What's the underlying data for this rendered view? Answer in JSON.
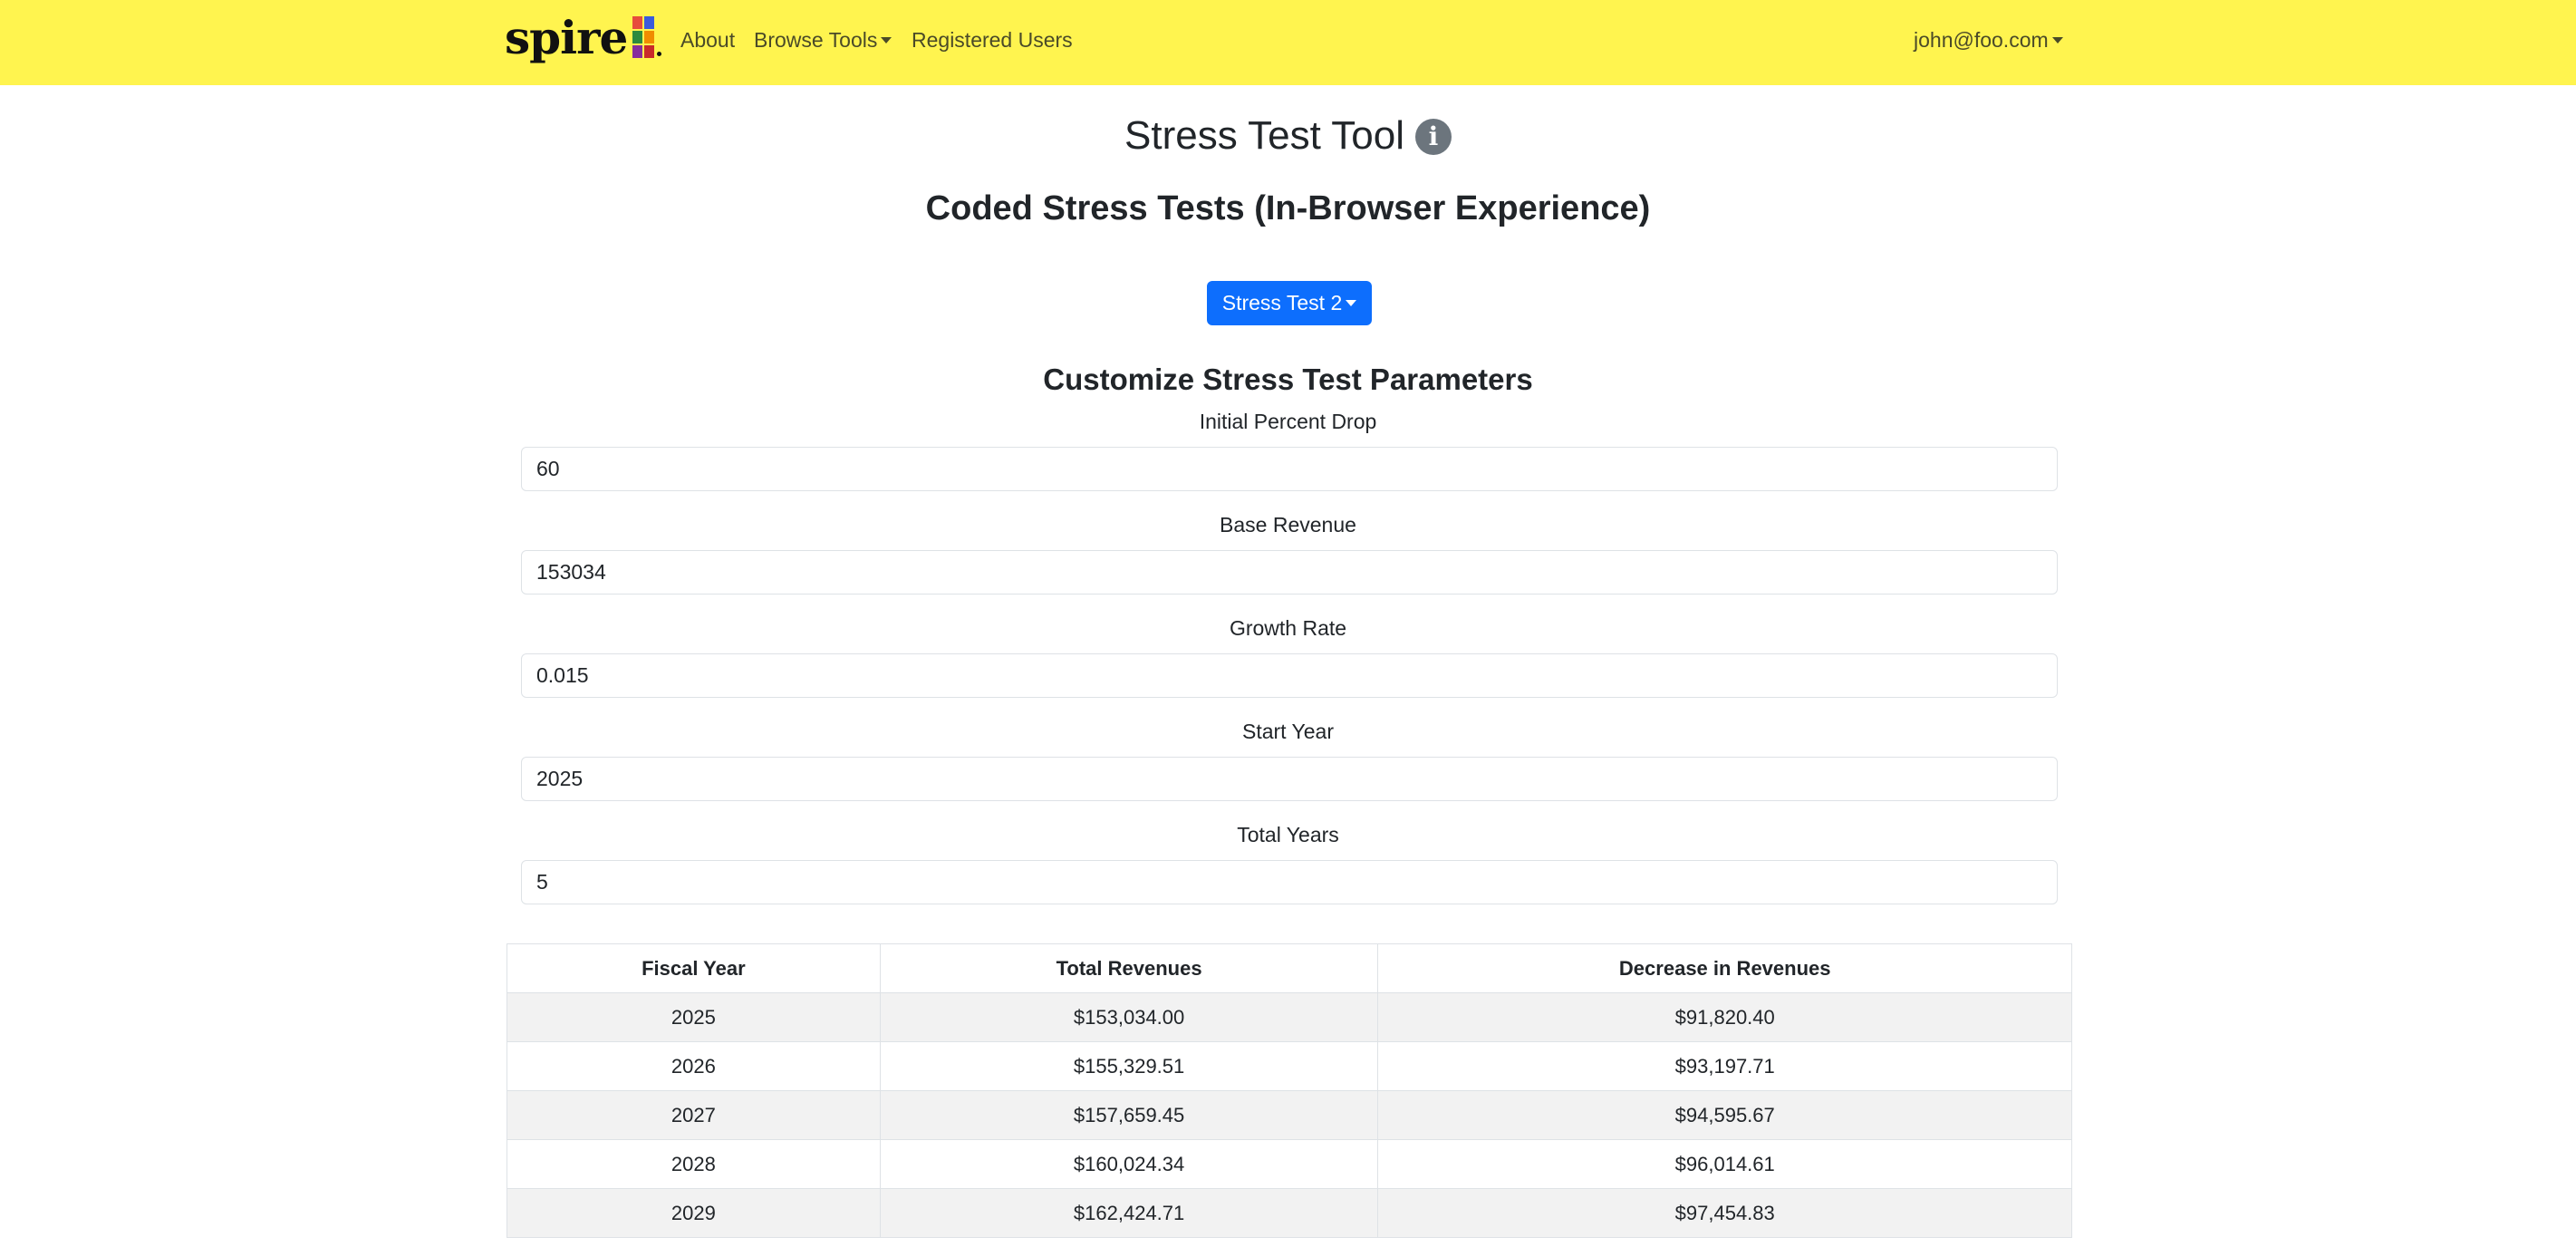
{
  "navbar": {
    "logo_text": "spire",
    "about": "About",
    "browse_tools": "Browse Tools",
    "registered_users": "Registered Users",
    "user_email": "john@foo.com"
  },
  "page": {
    "title": "Stress Test Tool",
    "info_glyph": "i",
    "subtitle": "Coded Stress Tests (In-Browser Experience)",
    "stress_test_selector": "Stress Test 2",
    "section_title": "Customize Stress Test Parameters"
  },
  "form": {
    "initial_percent_drop": {
      "label": "Initial Percent Drop",
      "value": "60"
    },
    "base_revenue": {
      "label": "Base Revenue",
      "value": "153034"
    },
    "growth_rate": {
      "label": "Growth Rate",
      "value": "0.015"
    },
    "start_year": {
      "label": "Start Year",
      "value": "2025"
    },
    "total_years": {
      "label": "Total Years",
      "value": "5"
    }
  },
  "table": {
    "headers": [
      "Fiscal Year",
      "Total Revenues",
      "Decrease in Revenues"
    ],
    "rows": [
      [
        "2025",
        "$153,034.00",
        "$91,820.40"
      ],
      [
        "2026",
        "$155,329.51",
        "$93,197.71"
      ],
      [
        "2027",
        "$157,659.45",
        "$94,595.67"
      ],
      [
        "2028",
        "$160,024.34",
        "$96,014.61"
      ],
      [
        "2029",
        "$162,424.71",
        "$97,454.83"
      ]
    ]
  },
  "colors": {
    "navbar_bg": "#fff44f",
    "primary_button": "#0d6efd",
    "info_icon": "#6c757d",
    "stripe_row": "#f2f2f2"
  }
}
